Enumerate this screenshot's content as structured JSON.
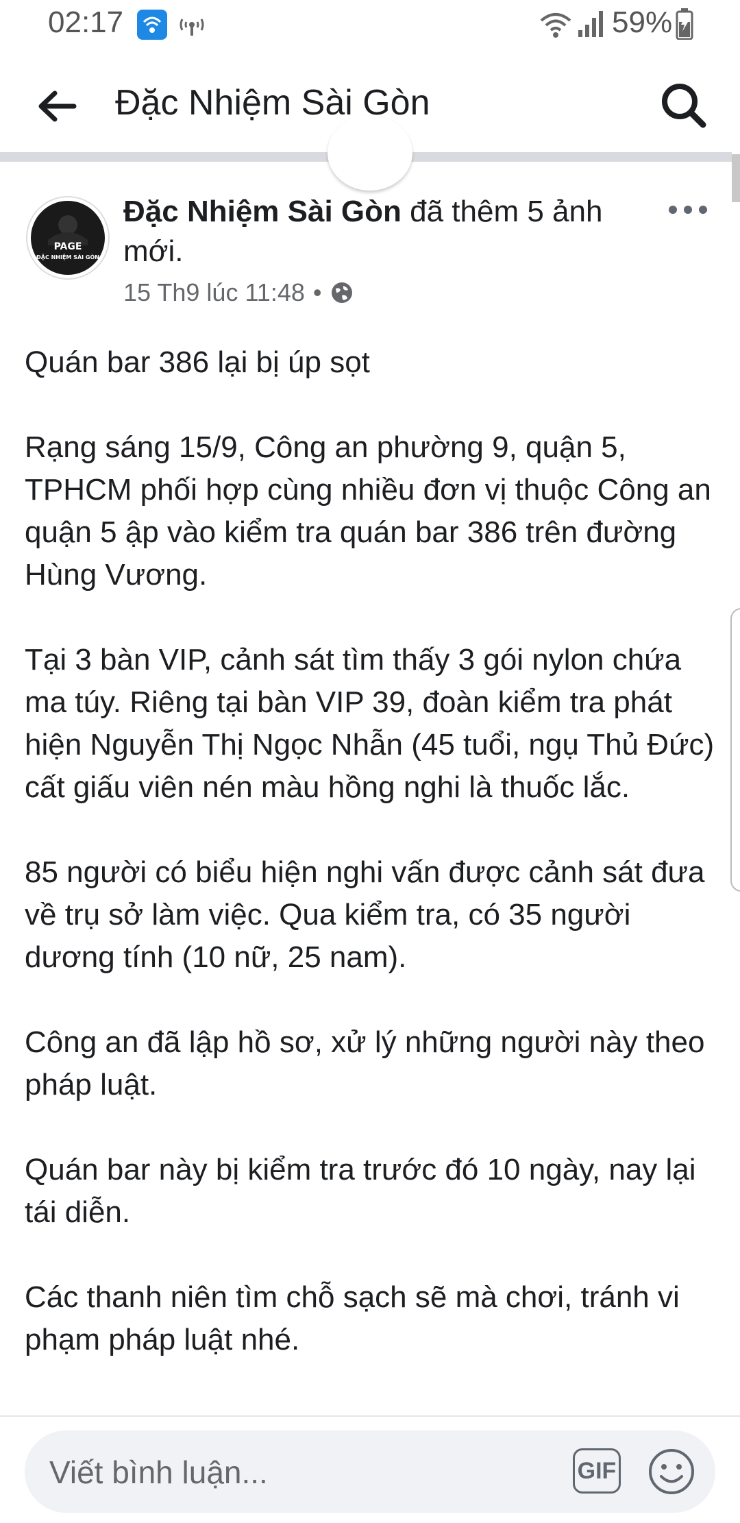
{
  "status_bar": {
    "time": "02:17",
    "battery": "59%"
  },
  "header": {
    "title": "Đặc Nhiệm Sài Gòn"
  },
  "post": {
    "author": "Đặc Nhiệm Sài Gòn",
    "action": "đã thêm 5 ảnh mới.",
    "timestamp": "15 Th9 lúc 11:48",
    "paragraphs": [
      "Quán bar 386 lại bị úp sọt",
      "Rạng sáng 15/9, Công an phường 9, quận 5, TPHCM phối hợp cùng nhiều đơn vị thuộc Công an quận 5 ập vào kiểm tra quán bar 386 trên đường Hùng Vương.",
      "Tại 3 bàn VIP, cảnh sát tìm thấy 3 gói nylon chứa ma túy. Riêng tại bàn VIP 39, đoàn kiểm tra phát hiện Nguyễn Thị Ngọc Nhẫn (45 tuổi, ngụ Thủ Đức) cất giấu viên nén màu hồng nghi là thuốc lắc.",
      "85 người có biểu hiện nghi vấn được cảnh sát đưa về trụ sở làm việc. Qua kiểm tra, có 35 người dương tính (10 nữ, 25 nam).",
      "Công an đã lập hồ sơ, xử lý những người này theo pháp luật.",
      "Quán bar này bị kiểm tra trước đó 10 ngày, nay lại tái diễn.",
      "Các thanh niên tìm chỗ sạch sẽ mà chơi, tránh vi phạm pháp luật nhé."
    ]
  },
  "composer": {
    "placeholder": "Viết bình luận...",
    "gif_label": "GIF"
  },
  "avatar_text": {
    "line1": "PAGE",
    "line2": "ĐẶC NHIỆM SÀI GÒN"
  }
}
